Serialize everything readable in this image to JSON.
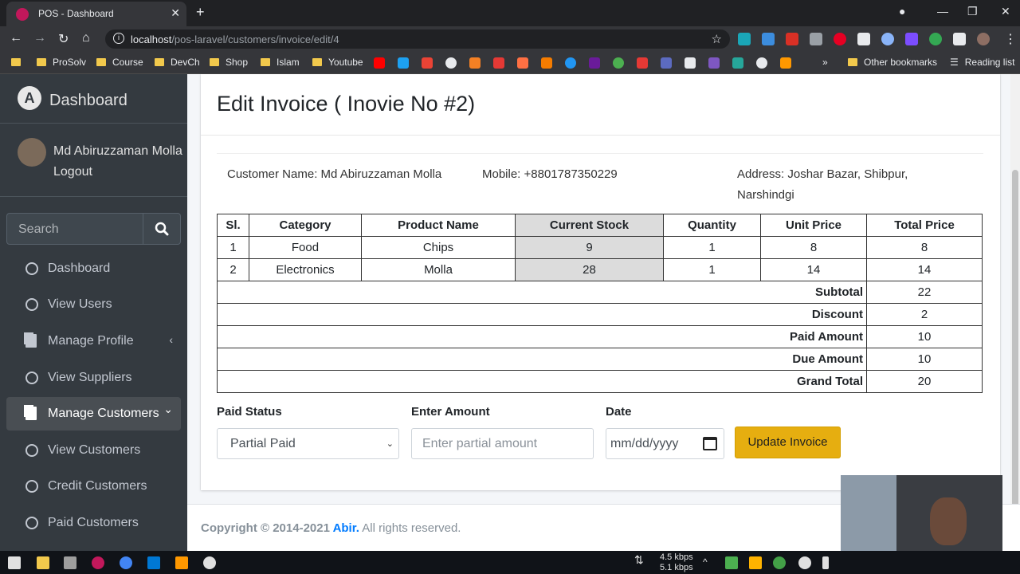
{
  "browser": {
    "tab_title": "POS - Dashboard",
    "tab_close": "✕",
    "new_tab": "+",
    "url_host": "localhost",
    "url_path": "/pos-laravel/customers/invoice/edit/4",
    "bookmarks": [
      "ProSolv",
      "Course",
      "DevCh",
      "Shop",
      "Islam",
      "Youtube"
    ],
    "other_bookmarks": "Other bookmarks",
    "reading_list": "Reading list",
    "more": "»"
  },
  "sidebar": {
    "brand": "Dashboard",
    "user_name": "Md Abiruzzaman Molla",
    "logout": "Logout",
    "search_placeholder": "Search",
    "items": [
      {
        "label": "Dashboard",
        "icon": "circle-icon"
      },
      {
        "label": "View Users",
        "icon": "circle-icon"
      },
      {
        "label": "Manage Profile",
        "icon": "copy-icon",
        "chevron": "‹"
      },
      {
        "label": "View Suppliers",
        "icon": "circle-icon"
      },
      {
        "label": "Manage Customers",
        "icon": "copy-icon",
        "chevron": "⌄",
        "active": true
      },
      {
        "label": "View Customers",
        "icon": "circle-icon"
      },
      {
        "label": "Credit Customers",
        "icon": "circle-icon"
      },
      {
        "label": "Paid Customers",
        "icon": "circle-icon"
      }
    ]
  },
  "main": {
    "title": "Edit Invoice ( Inovie No #2)",
    "customer_name": "Customer Name: Md Abiruzzaman Molla",
    "mobile": "Mobile: +8801787350229",
    "address_line1": "Address: Joshar Bazar, Shibpur,",
    "address_line2": "Narshindgi",
    "table": {
      "headers": [
        "Sl.",
        "Category",
        "Product Name",
        "Current Stock",
        "Quantity",
        "Unit Price",
        "Total Price"
      ],
      "rows": [
        [
          "1",
          "Food",
          "Chips",
          "9",
          "1",
          "8",
          "8"
        ],
        [
          "2",
          "Electronics",
          "Molla",
          "28",
          "1",
          "14",
          "14"
        ]
      ],
      "summary": [
        {
          "label": "Subtotal",
          "value": "22"
        },
        {
          "label": "Discount",
          "value": "2"
        },
        {
          "label": "Paid Amount",
          "value": "10"
        },
        {
          "label": "Due Amount",
          "value": "10"
        },
        {
          "label": "Grand Total",
          "value": "20"
        }
      ]
    },
    "form": {
      "paid_status_label": "Paid Status",
      "paid_status_value": "Partial Paid",
      "amount_label": "Enter Amount",
      "amount_placeholder": "Enter partial amount",
      "date_label": "Date",
      "date_placeholder": "mm/dd/yyyy",
      "update_button": "Update Invoice"
    }
  },
  "footer": {
    "copyright": "Copyright © 2014-2021 ",
    "author": "Abir.",
    "rights": " All rights reserved."
  },
  "taskbar": {
    "up_speed": "4.5 kbps",
    "down_speed": "5.1 kbps"
  }
}
